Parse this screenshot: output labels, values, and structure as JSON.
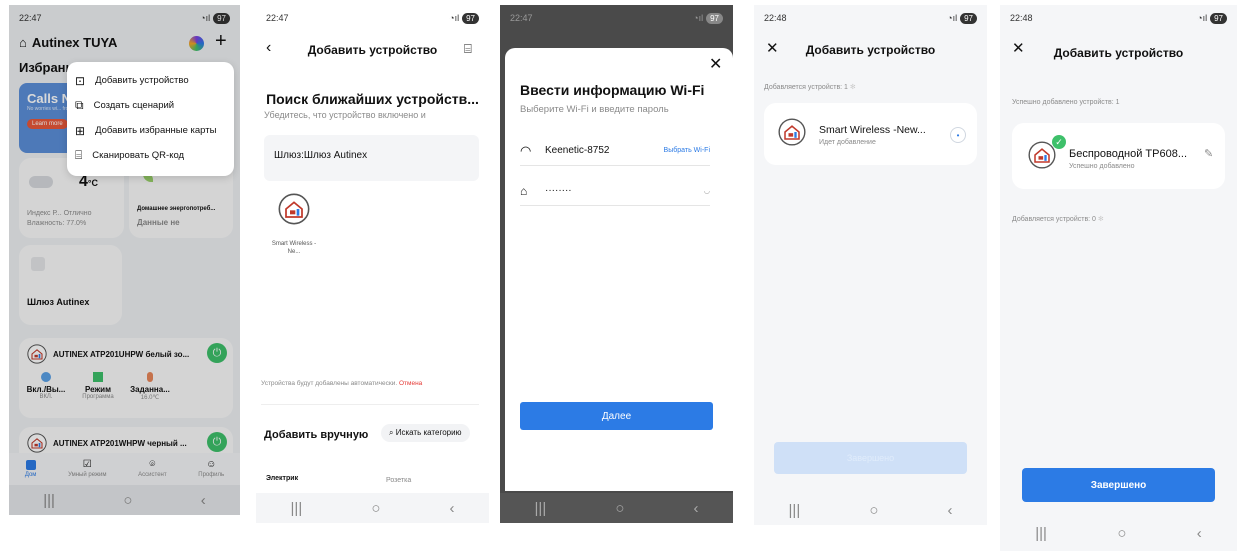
{
  "status": {
    "s1": {
      "time": "22:47",
      "battery": "97"
    },
    "s2": {
      "time": "22:47",
      "battery": "97"
    },
    "s3": {
      "time": "22:47",
      "battery": "97"
    },
    "s4": {
      "time": "22:48",
      "battery": "97"
    },
    "s5": {
      "time": "22:48",
      "battery": "97"
    }
  },
  "colors": {
    "accent": "#2c7be5",
    "green": "#3ec06a",
    "red": "#e53935"
  },
  "s1": {
    "home_name": "Autinex TUYA",
    "favorites_label": "Избранное",
    "banner_title": "Calls N",
    "banner_sub": "No worries wi... from home",
    "banner_btn": "Learn more",
    "menu": [
      {
        "label": "Добавить устройство",
        "icon": "add-device-icon"
      },
      {
        "label": "Создать сценарий",
        "icon": "create-scene-icon"
      },
      {
        "label": "Добавить избранные карты",
        "icon": "add-card-icon"
      },
      {
        "label": "Сканировать QR-код",
        "icon": "scan-qr-icon"
      }
    ],
    "weather": {
      "temp": "4",
      "unit": "°C",
      "index": "Индекс Р...",
      "quality": "Отлично",
      "humidity": "Влажность: 77.0%"
    },
    "energy": {
      "title": "Домашнее энергопотреб...",
      "value": "Данные не"
    },
    "gateway_card": "Шлюз Autinex",
    "device1": {
      "name": "AUTINEX ATP201UHPW белый зо...",
      "items": [
        {
          "title": "Вкл./Вы...",
          "sub": "ВКЛ."
        },
        {
          "title": "Режим",
          "sub": "Программа"
        },
        {
          "title": "Заданна...",
          "sub": "16.0℃"
        }
      ]
    },
    "device2": {
      "name": "AUTINEX ATP201WHPW черный ..."
    },
    "tabs": [
      "Дом",
      "Умный режим",
      "Ассистент",
      "Профиль"
    ]
  },
  "s2": {
    "title": "Добавить устройство",
    "search_title": "Поиск ближайших устройств...",
    "search_hint": "Убедитесь, что устройство включено и",
    "gateway": "Шлюз:Шлюз Autinex",
    "found_device": "Smart Wireless -Ne...",
    "auto_text": "Устройства будут добавлены автоматически.",
    "cancel": "Отмена",
    "manual": "Добавить вручную",
    "search_cat": "Искать категорию",
    "cat1": "Электрик",
    "cat2": "Розетка"
  },
  "s3": {
    "title": "Ввести информацию Wi-Fi",
    "subtitle": "Выберите Wi-Fi и введите пароль",
    "ssid": "Keenetic-8752",
    "choose_wifi": "Выбрать Wi-Fi",
    "password": "········",
    "next": "Далее"
  },
  "s4": {
    "title": "Добавить устройство",
    "adding_count": "Добавляется устройств: 1",
    "device_name": "Smart Wireless -New...",
    "device_status": "Идет добавление",
    "bottom_btn": "Завершено"
  },
  "s5": {
    "title": "Добавить устройство",
    "success_count": "Успешно добавлено устройств: 1",
    "device_name": "Беспроводной TP608...",
    "device_status": "Успешно добавлено",
    "adding_count": "Добавляется устройств: 0",
    "done": "Завершено"
  }
}
